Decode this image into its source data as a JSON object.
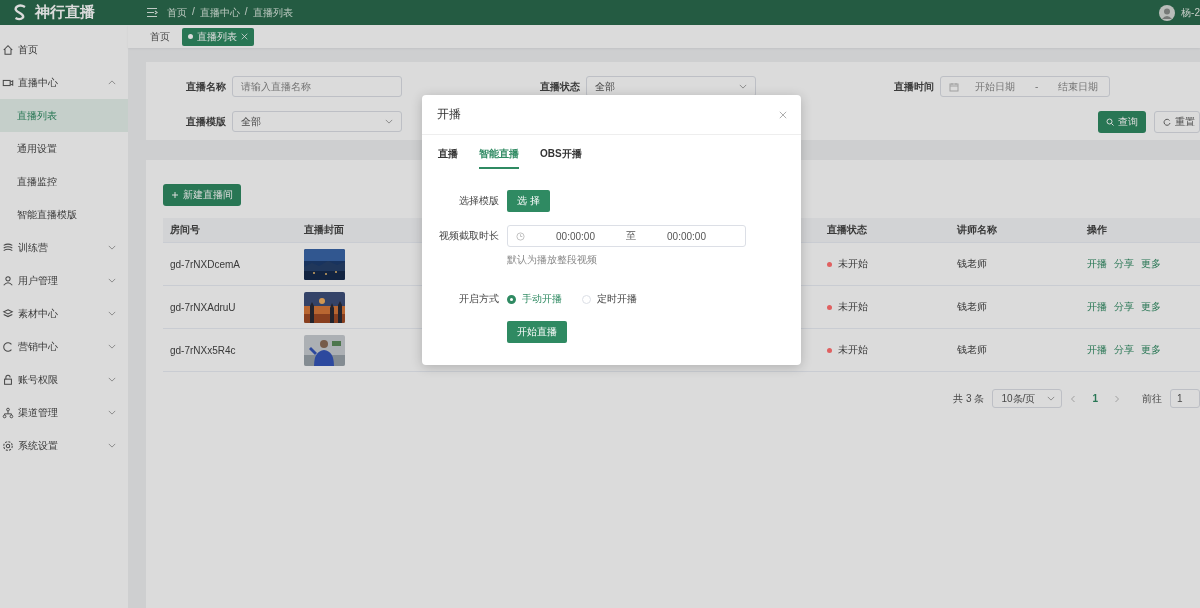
{
  "app": {
    "logo": "神行直播"
  },
  "breadcrumb": [
    "首页",
    "直播中心",
    "直播列表"
  ],
  "breadcrumb_separator": "/",
  "user": {
    "name": "杨-2"
  },
  "tags": [
    {
      "label": "首页",
      "selected": false
    },
    {
      "label": "直播列表",
      "selected": true
    }
  ],
  "sidebar": {
    "items": [
      {
        "label": "首页",
        "kind": "link",
        "selected": false
      },
      {
        "label": "直播中心",
        "kind": "group",
        "expanded": true,
        "children": [
          {
            "label": "直播列表",
            "selected": true
          },
          {
            "label": "通用设置",
            "selected": false
          },
          {
            "label": "直播监控",
            "selected": false
          },
          {
            "label": "智能直播模版",
            "selected": false
          }
        ]
      },
      {
        "label": "训练营",
        "kind": "group",
        "expanded": false
      },
      {
        "label": "用户管理",
        "kind": "group",
        "expanded": false
      },
      {
        "label": "素材中心",
        "kind": "group",
        "expanded": false
      },
      {
        "label": "营销中心",
        "kind": "group",
        "expanded": false
      },
      {
        "label": "账号权限",
        "kind": "group",
        "expanded": false
      },
      {
        "label": "渠道管理",
        "kind": "group",
        "expanded": false
      },
      {
        "label": "系统设置",
        "kind": "group",
        "expanded": false
      }
    ]
  },
  "filters": [
    {
      "label": "直播名称",
      "kind": "input",
      "placeholder": "请输入直播名称"
    },
    {
      "label": "直播状态",
      "kind": "select",
      "value": "全部"
    },
    {
      "label": "直播时间",
      "kind": "daterange",
      "start_placeholder": "开始日期",
      "separator": "-",
      "end_placeholder": "结束日期"
    },
    {
      "label": "直播模版",
      "kind": "select",
      "value": "全部"
    }
  ],
  "search_button": "查询",
  "reset_button": "重置",
  "table": {
    "new_button": "新建直播间",
    "columns": [
      "房间号",
      "直播封面",
      "直播状态",
      "讲师名称",
      "操作"
    ],
    "rows": [
      {
        "room": "gd-7rNXDcemA",
        "cover": {
          "kind": "picture"
        },
        "status": "未开始",
        "color": "#e06060",
        "teacher": "钱老师",
        "actions": [
          "开播",
          "分享",
          "更多"
        ]
      },
      {
        "room": "gd-7rNXAdruU",
        "cover": {
          "kind": "picture"
        },
        "status": "未开始",
        "color": "#e06060",
        "teacher": "钱老师",
        "actions": [
          "开播",
          "分享",
          "更多"
        ]
      },
      {
        "room": "gd-7rNXx5R4c",
        "cover": {
          "kind": "picture"
        },
        "status": "未开始",
        "color": "#e06060",
        "teacher": "钱老师",
        "actions": [
          "开播",
          "分享",
          "更多"
        ]
      }
    ]
  },
  "pagination": {
    "total": "共 3 条",
    "page_size": "10条/页",
    "pages": [
      {
        "label": "1",
        "selected": true
      }
    ],
    "goto_label": "前往",
    "goto_value": "1"
  },
  "modal": {
    "title": "开播",
    "tabs": [
      {
        "label": "直播",
        "selected": false
      },
      {
        "label": "智能直播",
        "selected": true
      },
      {
        "label": "OBS开播",
        "selected": false
      }
    ],
    "template_label": "选择模版",
    "template_button": "选 择",
    "duration_label": "视频截取时长",
    "duration_start": "00:00:00",
    "duration_separator": "至",
    "duration_end": "00:00:00",
    "duration_hint": "默认为播放整段视频",
    "mode_label": "开启方式",
    "mode_options": [
      {
        "label": "手动开播",
        "selected": true
      },
      {
        "label": "定时开播",
        "selected": false
      }
    ],
    "submit_button": "开始直播"
  }
}
